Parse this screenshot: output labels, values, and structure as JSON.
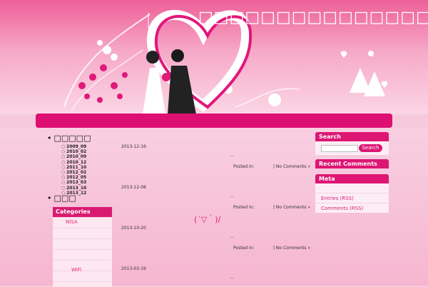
{
  "header": {
    "site_title": "□□□□□□□□□□□□□□□□□□"
  },
  "left_sidebar": {
    "archives_heading": "□□□□□",
    "archives": [
      "2009_09",
      "2010_02",
      "2010_09",
      "2010_12",
      "2011_10",
      "2012_02",
      "2012_05",
      "2013_03",
      "2013_10",
      "2013_12"
    ],
    "second_heading": "□□□",
    "categories_title": "Categories",
    "categories": [
      "NISA",
      "WiFi"
    ]
  },
  "posts": [
    {
      "date": "2013-12-16",
      "posted_in": "Posted in:",
      "comments": "| No Comments »"
    },
    {
      "date": "2013-12-08",
      "posted_in": "Posted in:",
      "comments": "| No Comments »"
    },
    {
      "date": "2013-10-20",
      "posted_in": "Posted in:",
      "comments": "| No Comments »"
    },
    {
      "date": "2013-03-19"
    }
  ],
  "post_dash": "--",
  "emoticon": "(´▽｀)/",
  "right_sidebar": {
    "search_title": "Search",
    "search_button": "Search",
    "recent_title": "Recent Comments",
    "meta_title": "Meta",
    "meta_links": [
      "Entries (RSS)",
      "Comments (RSS)"
    ]
  },
  "colors": {
    "primary_pink": "#dd0f72",
    "link_pink": "#e8257a",
    "background": "#f7c9dd"
  }
}
